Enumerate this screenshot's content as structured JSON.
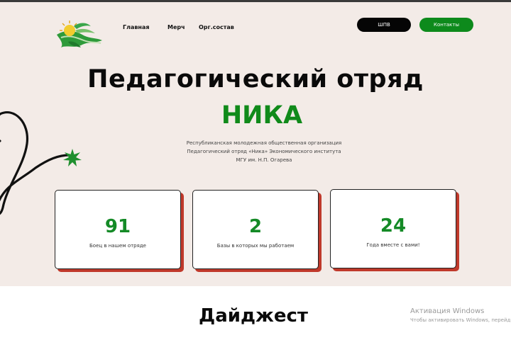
{
  "nav": {
    "items": [
      {
        "label": "Главная"
      },
      {
        "label": "Мерч"
      },
      {
        "label": "Орг.состав"
      }
    ],
    "shpv_button": "ШПВ",
    "contacts_button": "Контакты"
  },
  "hero": {
    "title": "Педагогический отряд",
    "subtitle": "НИКА",
    "description": [
      "Республиканская молодежная общественная организация",
      "Педагогический отряд «Ника» Экономического института",
      "МГУ им. Н.П. Огарева"
    ]
  },
  "stats": [
    {
      "value": "91",
      "label": "Боец в нашем отряде"
    },
    {
      "value": "2",
      "label": "Базы в которых мы работаем"
    },
    {
      "value": "24",
      "label": "Года вместе с вами!"
    }
  ],
  "digest": {
    "title": "Дайджест"
  },
  "watermark": {
    "line1": "Активация Windows",
    "line2": "Чтобы активировать Windows, перейдит"
  },
  "colors": {
    "hero_bg": "#f3ebe7",
    "accent_green": "#108a1a",
    "card_shadow": "#c0392b",
    "dark_button": "#050505"
  },
  "icons": [
    "logo-icon",
    "squiggle-decoration",
    "star-splat-icon"
  ]
}
